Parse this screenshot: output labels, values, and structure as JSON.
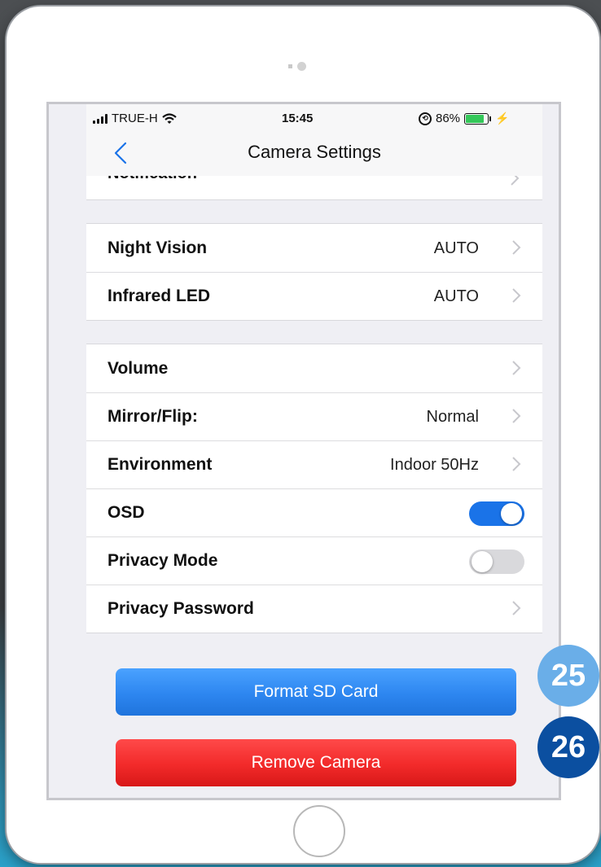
{
  "status_bar": {
    "carrier": "TRUE-H",
    "time": "15:45",
    "battery_percent": "86%",
    "battery_fill": 0.86,
    "battery_color": "#34c759"
  },
  "nav": {
    "back_icon": "chevron-left-icon",
    "title": "Camera Settings"
  },
  "partial_row": {
    "label": "Notification"
  },
  "group1": [
    {
      "label": "Night Vision",
      "value": "AUTO"
    },
    {
      "label": "Infrared LED",
      "value": "AUTO"
    }
  ],
  "group2": [
    {
      "label": "Volume",
      "value": ""
    },
    {
      "label": "Mirror/Flip:",
      "value": "Normal"
    },
    {
      "label": "Environment",
      "value": "Indoor 50Hz"
    },
    {
      "label": "OSD",
      "toggle": true
    },
    {
      "label": "Privacy Mode",
      "toggle": false
    },
    {
      "label": "Privacy Password",
      "value": ""
    }
  ],
  "buttons": {
    "format": "Format SD Card",
    "remove": "Remove Camera"
  },
  "badges": [
    "25",
    "26"
  ],
  "colors": {
    "accent": "#1a73e8",
    "format_button": "#2d86f0",
    "remove_button": "#f22a2a",
    "badge_light": "#6aaee8",
    "badge_dark": "#0b4fa0"
  }
}
